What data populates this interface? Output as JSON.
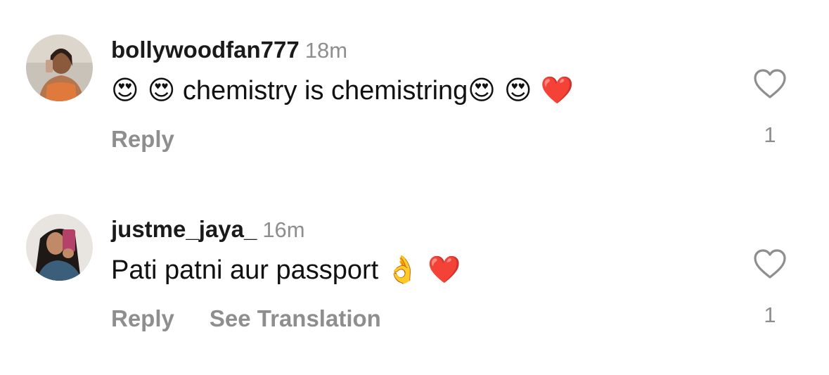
{
  "comments": [
    {
      "username": "bollywoodfan777",
      "time": "18m",
      "text": "chemistry is chemistring",
      "emoji_before": "😍 😍",
      "emoji_after": "😍 😍 ❤️",
      "actions": [
        "Reply"
      ],
      "like_count": "1",
      "avatar_icon": "profile-photo-woman-orange-top"
    },
    {
      "username": "justme_jaya_",
      "time": "16m",
      "text": "Pati patni aur passport",
      "emoji_before": "",
      "emoji_after": "👌 ❤️",
      "actions": [
        "Reply",
        "See Translation"
      ],
      "like_count": "1",
      "avatar_icon": "profile-photo-woman-pink-phone"
    }
  ],
  "colors": {
    "text": "#111111",
    "muted": "#8e8e8e",
    "background": "#ffffff"
  }
}
